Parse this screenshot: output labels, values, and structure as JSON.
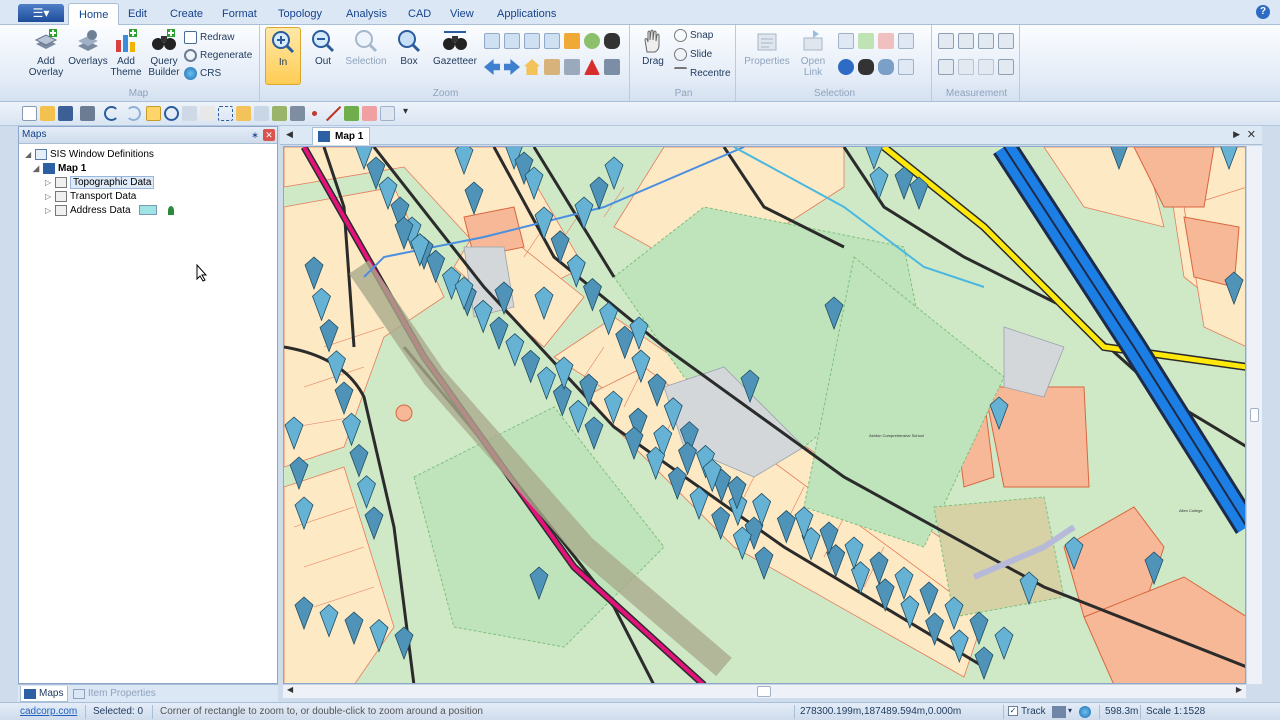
{
  "ribbon_tabs": [
    "Home",
    "Edit",
    "Create",
    "Format",
    "Topology",
    "Analysis",
    "CAD",
    "View",
    "Applications"
  ],
  "active_tab": "Home",
  "groups": {
    "map": {
      "label": "Map",
      "add_overlay": "Add Overlay",
      "overlays": "Overlays",
      "add_theme": "Add Theme",
      "query_builder": "Query Builder",
      "redraw": "Redraw",
      "regenerate": "Regenerate",
      "crs": "CRS"
    },
    "zoom": {
      "label": "Zoom",
      "in": "In",
      "out": "Out",
      "selection": "Selection",
      "box": "Box",
      "gazetteer": "Gazetteer"
    },
    "pan": {
      "label": "Pan",
      "drag": "Drag",
      "snap": "Snap",
      "slide": "Slide",
      "recentre": "Recentre"
    },
    "selection": {
      "label": "Selection",
      "properties": "Properties",
      "open_link": "Open Link"
    },
    "measurement": {
      "label": "Measurement"
    }
  },
  "panel": {
    "title": "Maps",
    "tree": {
      "root": "SIS Window Definitions",
      "map": "Map 1",
      "layers": [
        "Topographic Data",
        "Transport Data",
        "Address Data"
      ]
    },
    "bottom_tabs": [
      "Maps",
      "Item Properties"
    ]
  },
  "map_tab": "Map 1",
  "map_labels": [
    "Ashton Comprehensive School",
    "Allen College"
  ],
  "status": {
    "link": "cadcorp.com",
    "selected": "Selected: 0",
    "hint": "Corner of rectangle to zoom to, or double-click to zoom around a position",
    "coords": "278300.199m,187489.594m,0.000m",
    "track": "Track",
    "width": "598.3m",
    "scale_label": "Scale 1:",
    "scale_value": "1528"
  },
  "colors": {
    "accent": "#2d6bc5",
    "park": "#cfe9c7",
    "building": "#f6b896",
    "rail_pink": "#e4137b",
    "road_blue": "#1c7fe6",
    "road_yellow": "#ffe80a",
    "marker": "#5aa6c8"
  }
}
